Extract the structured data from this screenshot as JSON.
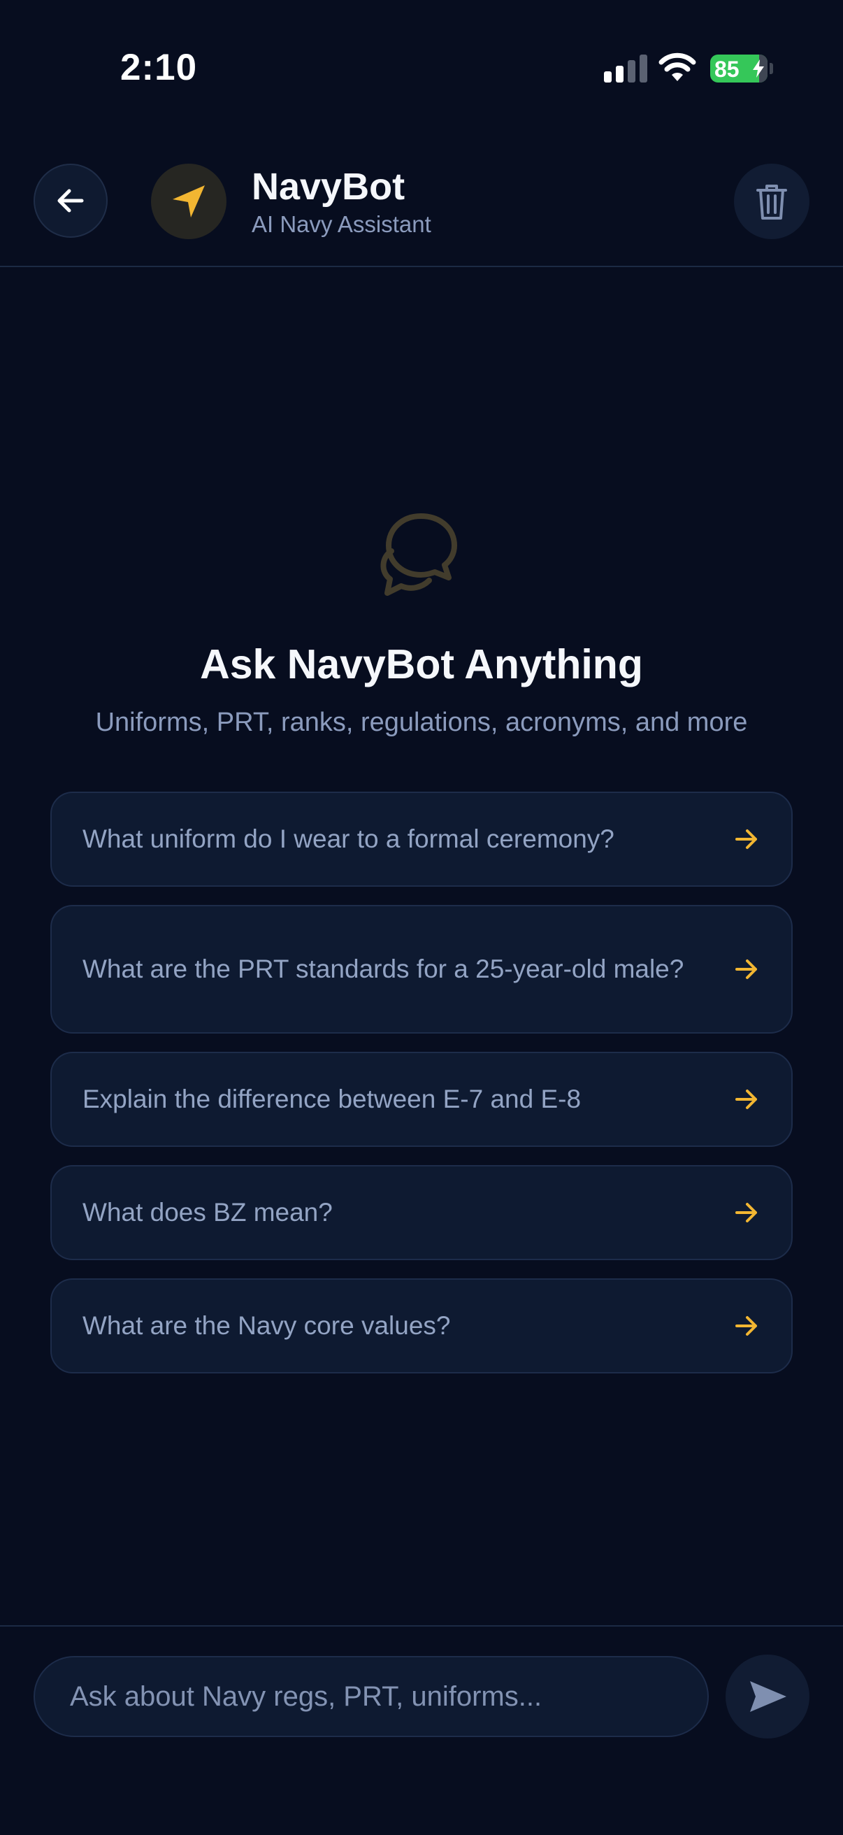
{
  "status_bar": {
    "time": "2:10",
    "battery_percent": "85"
  },
  "header": {
    "title": "NavyBot",
    "subtitle": "AI Navy Assistant"
  },
  "empty_state": {
    "title": "Ask NavyBot Anything",
    "subtitle": "Uniforms, PRT, ranks, regulations, acronyms, and more"
  },
  "suggestions": [
    {
      "text": "What uniform do I wear to a formal ceremony?"
    },
    {
      "text": "What are the PRT standards for a 25-year-old male?"
    },
    {
      "text": "Explain the difference between E-7 and E-8"
    },
    {
      "text": "What does BZ mean?"
    },
    {
      "text": "What are the Navy core values?"
    }
  ],
  "composer": {
    "placeholder": "Ask about Navy regs, PRT, uniforms..."
  },
  "colors": {
    "background": "#070d1f",
    "accent": "#f2b632",
    "card": "#0e1a31",
    "muted_text": "#8b9bbd"
  }
}
